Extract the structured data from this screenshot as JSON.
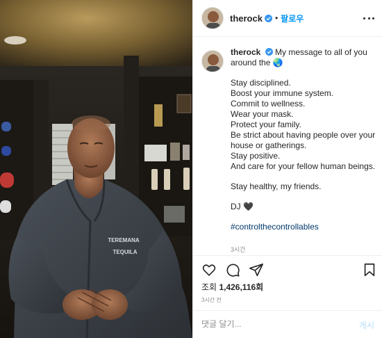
{
  "post": {
    "username": "therock",
    "follow_label": "팔로우",
    "separator": "•",
    "more_icon": "more-horizontal-icon",
    "verified_icon": "verified-badge-icon"
  },
  "caption": {
    "username": "therock",
    "first_line": "My message to all of you around the 🌏",
    "lines": [
      "Stay disciplined.",
      "Boost your immune system.",
      "Commit to wellness.",
      "Wear your mask.",
      "Protect your family.",
      "Be strict about having people over your",
      "house or gatherings.",
      "Stay positive.",
      "And care for your fellow human beings."
    ],
    "closing": "Stay healthy, my friends.",
    "signature": "DJ 🖤",
    "hashtag": "#controlthecontrollables",
    "time": "3시간"
  },
  "actions": {
    "like_icon": "heart-icon",
    "comment_icon": "comment-icon",
    "share_icon": "paper-plane-icon",
    "save_icon": "bookmark-icon"
  },
  "stats": {
    "views_label": "조회",
    "views": "1,426,116회",
    "posted": "3시간 전"
  },
  "comment": {
    "placeholder": "댓글 달기...",
    "post_label": "게시"
  },
  "media": {
    "shirt_text_top": "TEREMANA",
    "shirt_text_bottom": "TEQUILA"
  },
  "colors": {
    "link_blue": "#0095f6",
    "hashtag": "#00376b",
    "muted": "#8e8e8e",
    "border": "#efefef"
  }
}
